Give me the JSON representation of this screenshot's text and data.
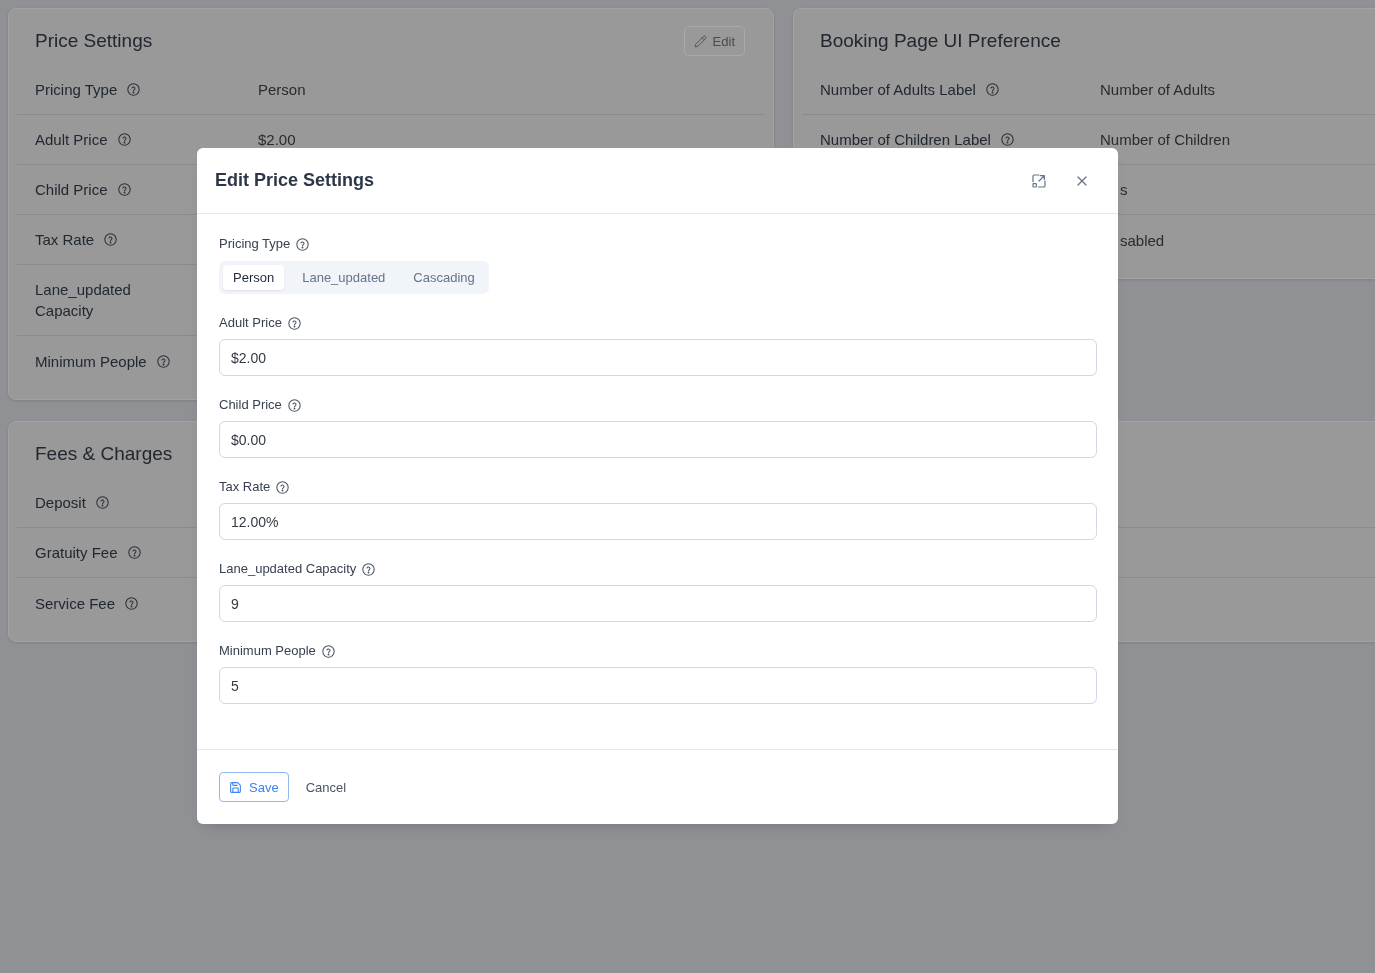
{
  "cards": [
    {
      "title": "Price Settings",
      "edit_button": "Edit",
      "rows": [
        {
          "label": "Pricing Type",
          "help_icon": true,
          "value": "Person"
        },
        {
          "label": "Adult Price",
          "help_icon": true,
          "value": "$2.00"
        },
        {
          "label": "Child Price",
          "help_icon": true
        },
        {
          "label": "Tax Rate",
          "help_icon": true
        },
        {
          "label": "Lane_updated Capacity"
        },
        {
          "label": "Minimum People",
          "help_icon": true
        }
      ]
    },
    {
      "title": "Booking Page UI Preference",
      "rows": [
        {
          "label": "Number of Adults Label",
          "help_icon": true,
          "value": "Number of Adults"
        },
        {
          "label": "Number of Children Label",
          "help_icon": true,
          "value": "Number of Children"
        },
        {
          "value": "s"
        },
        {
          "value": "sabled"
        }
      ]
    },
    {
      "title": "Fees & Charges",
      "rows": [
        {
          "label": "Deposit",
          "help_icon": true
        },
        {
          "label": "Gratuity Fee",
          "help_icon": true
        },
        {
          "label": "Service Fee",
          "help_icon": true
        }
      ]
    }
  ],
  "modal": {
    "title": "Edit Price Settings",
    "fields": [
      {
        "kind": "segmented",
        "label": "Pricing Type",
        "options": [
          {
            "label": "Person",
            "selected": true
          },
          {
            "label": "Lane_updated",
            "selected": false
          },
          {
            "label": "Cascading",
            "selected": false
          }
        ]
      },
      {
        "kind": "input",
        "label": "Adult Price",
        "value": "$2.00"
      },
      {
        "kind": "input",
        "label": "Child Price",
        "value": "$0.00"
      },
      {
        "kind": "input",
        "label": "Tax Rate",
        "value": "12.00%"
      },
      {
        "kind": "input",
        "label": "Lane_updated Capacity",
        "value": "9"
      },
      {
        "kind": "input",
        "label": "Minimum People",
        "value": "5"
      }
    ],
    "save_button": "Save",
    "cancel_button": "Cancel"
  }
}
